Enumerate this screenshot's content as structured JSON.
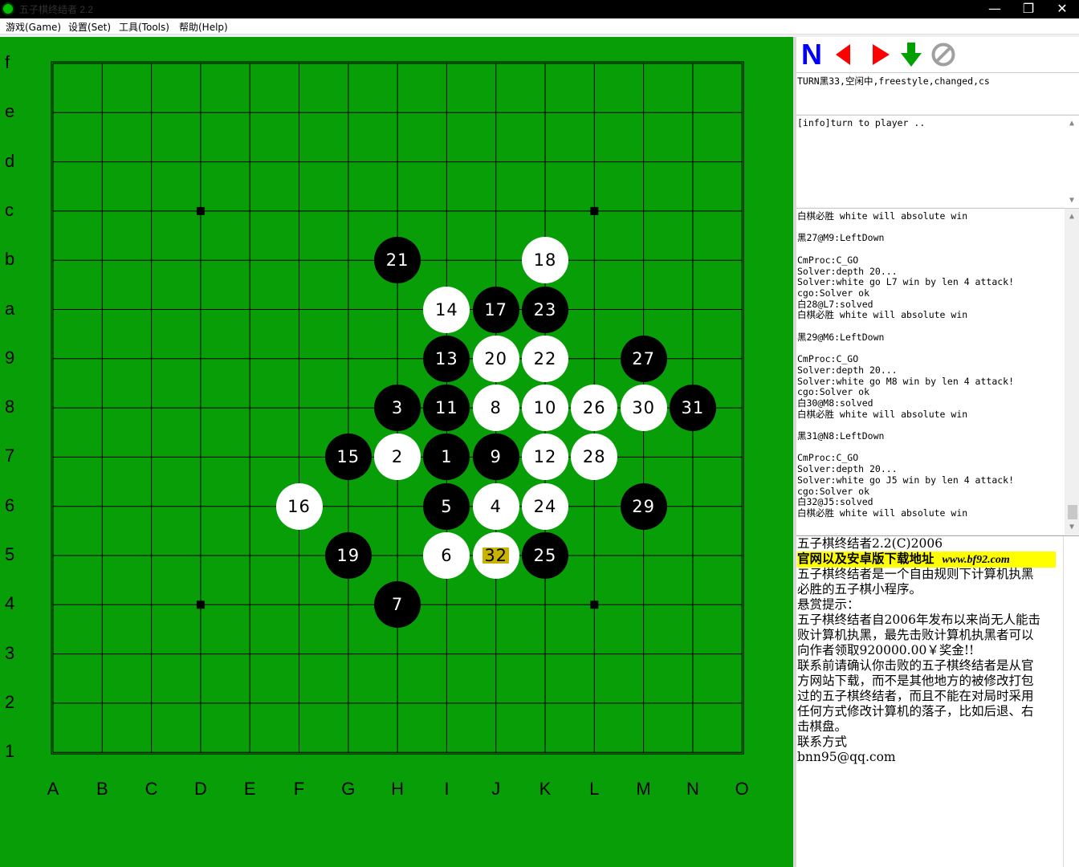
{
  "window": {
    "title": "五子棋终结者 2.2",
    "controls": {
      "minimize": "—",
      "maximize": "❐",
      "close": "✕"
    }
  },
  "menu": [
    {
      "label": "游戏(Game)"
    },
    {
      "label": "设置(Set)"
    },
    {
      "label": "工具(Tools)"
    },
    {
      "label": "帮助(Help)"
    }
  ],
  "board": {
    "size": 15,
    "background_color": "#079e07",
    "row_labels": [
      "f",
      "e",
      "d",
      "c",
      "b",
      "a",
      "9",
      "8",
      "7",
      "6",
      "5",
      "4",
      "3",
      "2",
      "1"
    ],
    "col_labels": [
      "A",
      "B",
      "C",
      "D",
      "E",
      "F",
      "G",
      "H",
      "I",
      "J",
      "K",
      "L",
      "M",
      "N",
      "O"
    ],
    "star_points": [
      "D12",
      "L12",
      "D4",
      "L4"
    ],
    "stones": [
      {
        "n": 1,
        "color": "black",
        "col": "I",
        "row": "7"
      },
      {
        "n": 2,
        "color": "white",
        "col": "H",
        "row": "7"
      },
      {
        "n": 3,
        "color": "black",
        "col": "H",
        "row": "8"
      },
      {
        "n": 4,
        "color": "white",
        "col": "J",
        "row": "6"
      },
      {
        "n": 5,
        "color": "black",
        "col": "I",
        "row": "6"
      },
      {
        "n": 6,
        "color": "white",
        "col": "I",
        "row": "5"
      },
      {
        "n": 7,
        "color": "black",
        "col": "H",
        "row": "4"
      },
      {
        "n": 8,
        "color": "white",
        "col": "J",
        "row": "8"
      },
      {
        "n": 9,
        "color": "black",
        "col": "J",
        "row": "7"
      },
      {
        "n": 10,
        "color": "white",
        "col": "K",
        "row": "8"
      },
      {
        "n": 11,
        "color": "black",
        "col": "I",
        "row": "8"
      },
      {
        "n": 12,
        "color": "white",
        "col": "K",
        "row": "7"
      },
      {
        "n": 13,
        "color": "black",
        "col": "I",
        "row": "9"
      },
      {
        "n": 14,
        "color": "white",
        "col": "I",
        "row": "a"
      },
      {
        "n": 15,
        "color": "black",
        "col": "G",
        "row": "7"
      },
      {
        "n": 16,
        "color": "white",
        "col": "F",
        "row": "6"
      },
      {
        "n": 17,
        "color": "black",
        "col": "J",
        "row": "a"
      },
      {
        "n": 18,
        "color": "white",
        "col": "K",
        "row": "b"
      },
      {
        "n": 19,
        "color": "black",
        "col": "G",
        "row": "5"
      },
      {
        "n": 20,
        "color": "white",
        "col": "J",
        "row": "9"
      },
      {
        "n": 21,
        "color": "black",
        "col": "H",
        "row": "b"
      },
      {
        "n": 22,
        "color": "white",
        "col": "K",
        "row": "9"
      },
      {
        "n": 23,
        "color": "black",
        "col": "K",
        "row": "a"
      },
      {
        "n": 24,
        "color": "white",
        "col": "K",
        "row": "6"
      },
      {
        "n": 25,
        "color": "black",
        "col": "K",
        "row": "5"
      },
      {
        "n": 26,
        "color": "white",
        "col": "L",
        "row": "8"
      },
      {
        "n": 27,
        "color": "black",
        "col": "M",
        "row": "9"
      },
      {
        "n": 28,
        "color": "white",
        "col": "L",
        "row": "7"
      },
      {
        "n": 29,
        "color": "black",
        "col": "M",
        "row": "6"
      },
      {
        "n": 30,
        "color": "white",
        "col": "M",
        "row": "8"
      },
      {
        "n": 31,
        "color": "black",
        "col": "N",
        "row": "8"
      },
      {
        "n": 32,
        "color": "white",
        "col": "J",
        "row": "5",
        "last": true
      }
    ]
  },
  "toolbar": {
    "new_label": "N",
    "icons": [
      "back-arrow-icon",
      "forward-arrow-icon",
      "down-arrow-icon",
      "stop-icon"
    ],
    "colors": {
      "new": "#0000ff",
      "back": "#ff0000",
      "forward": "#ff0000",
      "down": "#00a000",
      "stop": "#a0a0a0"
    }
  },
  "status": {
    "text": "TURN黑33,空闲中,freestyle,changed,cs"
  },
  "info": {
    "text": "[info]turn to player .."
  },
  "log": [
    "白棋必胜 white will absolute win",
    "",
    "黑27@M9:LeftDown",
    "",
    "CmProc:C_GO",
    "Solver:depth 20...",
    "Solver:white go L7 win by len 4 attack!",
    "cgo:Solver ok",
    "白28@L7:solved",
    "白棋必胜 white will absolute win",
    "",
    "黑29@M6:LeftDown",
    "",
    "CmProc:C_GO",
    "Solver:depth 20...",
    "Solver:white go M8 win by len 4 attack!",
    "cgo:Solver ok",
    "白30@M8:solved",
    "白棋必胜 white will absolute win",
    "",
    "黑31@N8:LeftDown",
    "",
    "CmProc:C_GO",
    "Solver:depth 20...",
    "Solver:white go J5 win by len 4 attack!",
    "cgo:Solver ok",
    "白32@J5:solved",
    "白棋必胜 white will absolute win"
  ],
  "about": {
    "line1": "五子棋终结者2.2(C)2006",
    "highlight_text": "官网以及安卓版下载地址",
    "highlight_url": "www.bf92.com",
    "lines": [
      "五子棋终结者是一个自由规则下计算机执黑",
      "必胜的五子棋小程序。",
      "悬赏提示：",
      "五子棋终结者自2006年发布以来尚无人能击",
      "败计算机执黑，最先击败计算机执黑者可以",
      "向作者领取920000.00￥奖金!!",
      "联系前请确认你击败的五子棋终结者是从官",
      "方网站下载，而不是其他地方的被修改打包",
      "过的五子棋终结者，而且不能在对局时采用",
      "任何方式修改计算机的落子，比如后退、右",
      "击棋盘。",
      "联系方式",
      "bnn95@qq.com"
    ]
  }
}
